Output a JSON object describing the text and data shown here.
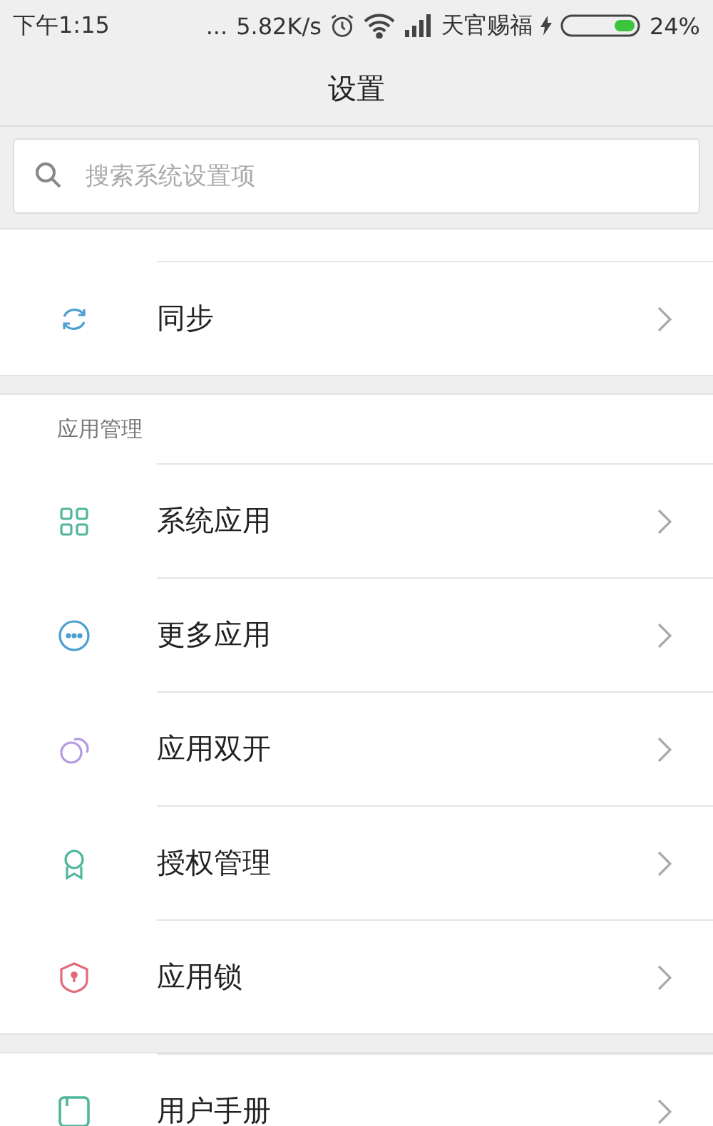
{
  "status_bar": {
    "time": "下午1:15",
    "more": "...",
    "speed": "5.82K/s",
    "carrier": "天官赐福",
    "battery": "24%"
  },
  "title": "设置",
  "search": {
    "placeholder": "搜索系统设置项"
  },
  "sections": [
    {
      "items": [
        {
          "kind": "sync",
          "label": "同步"
        }
      ]
    },
    {
      "header": "应用管理",
      "items": [
        {
          "kind": "grid",
          "label": "系统应用"
        },
        {
          "kind": "more",
          "label": "更多应用"
        },
        {
          "kind": "dual",
          "label": "应用双开"
        },
        {
          "kind": "award",
          "label": "授权管理"
        },
        {
          "kind": "shield",
          "label": "应用锁"
        }
      ]
    },
    {
      "items": [
        {
          "kind": "book",
          "label": "用户手册"
        }
      ]
    }
  ]
}
